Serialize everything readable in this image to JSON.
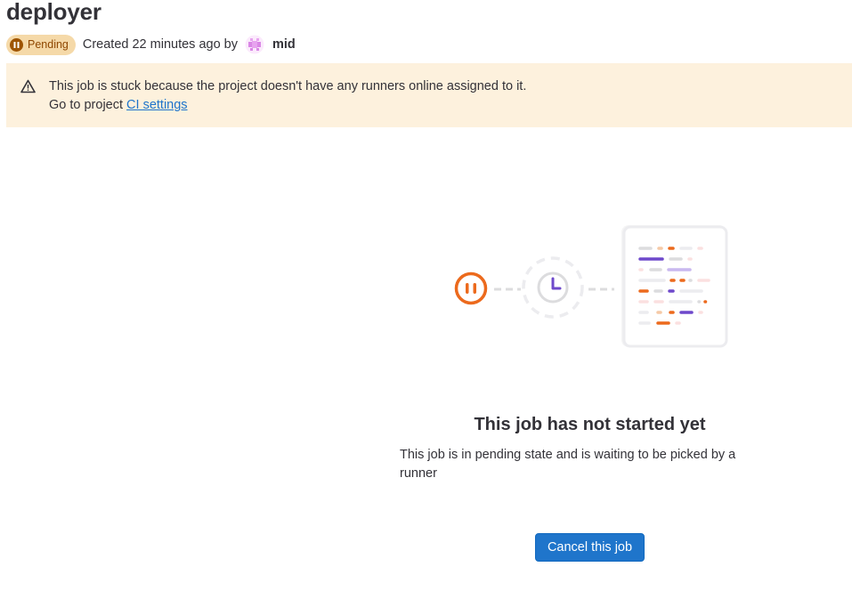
{
  "page": {
    "title": "deployer"
  },
  "job_meta": {
    "status_label": "Pending",
    "status_icon": "pause-icon",
    "created_text": "Created 22 minutes ago by",
    "username": "mid",
    "avatar_icon": "identicon-avatar"
  },
  "alert": {
    "icon": "warning-icon",
    "message": "This job is stuck because the project doesn't have any runners online assigned to it.",
    "link_prefix": "Go to project",
    "link_text": "CI settings"
  },
  "empty_state": {
    "illustration": "pending-job-illustration",
    "title": "This job has not started yet",
    "description": "This job is in pending state and is waiting to be picked by a runner",
    "cancel_label": "Cancel this job"
  },
  "colors": {
    "badge_bg": "#f5d9a8",
    "badge_text": "#8f4700",
    "alert_bg": "#fdf1dd",
    "link": "#1f75cb",
    "primary_button": "#1f75cb",
    "accent_orange": "#ec6a1d",
    "accent_purple": "#6e49cb"
  }
}
